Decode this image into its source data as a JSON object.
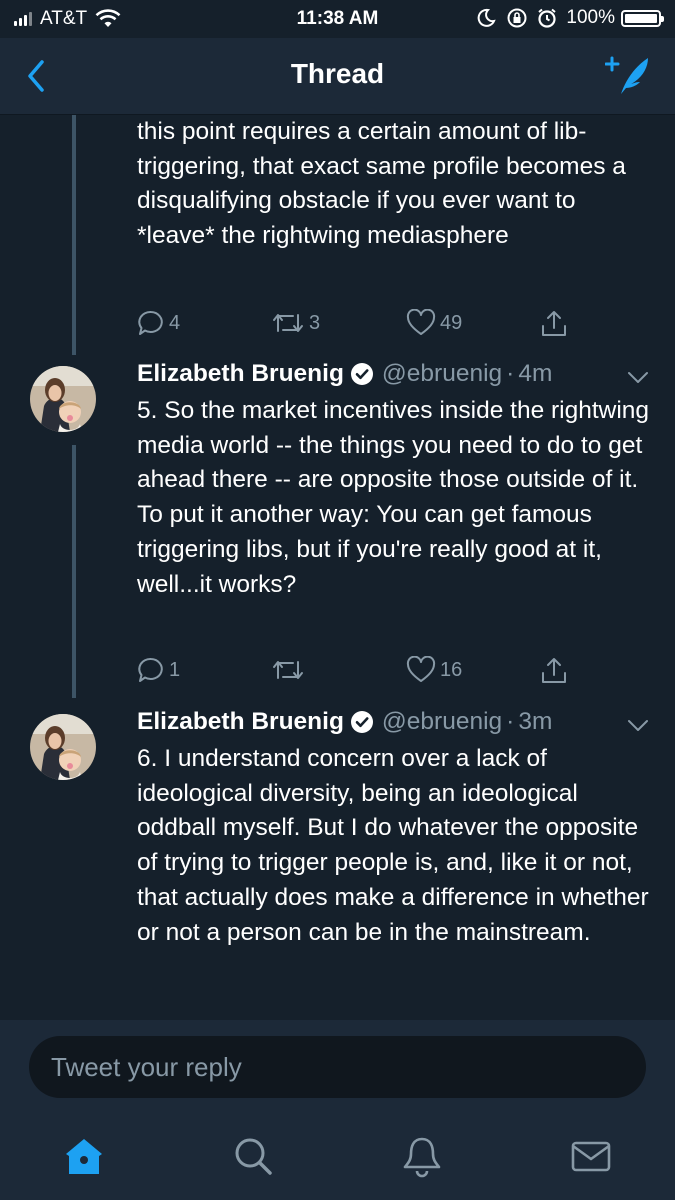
{
  "status_bar": {
    "carrier": "AT&T",
    "time": "11:38 AM",
    "battery": "100%"
  },
  "header": {
    "title": "Thread",
    "back_icon": "chevron-left-icon",
    "compose_icon": "compose-tweet-icon"
  },
  "tweets": [
    {
      "text": "this point requires a certain amount of lib-triggering, that exact same profile becomes a disqualifying obstacle if you ever want to *leave* the rightwing mediasphere",
      "replies": "4",
      "retweets": "3",
      "likes": "49"
    },
    {
      "name": "Elizabeth Bruenig",
      "handle": "@ebruenig",
      "separator": "·",
      "time": "4m",
      "text": "5. So the market incentives inside the rightwing media world -- the things you need to do to get ahead there -- are opposite those outside of it. To put it another way: You can get famous triggering libs, but if you're really good at it, well...it works?",
      "replies": "1",
      "retweets": "",
      "likes": "16"
    },
    {
      "name": "Elizabeth Bruenig",
      "handle": "@ebruenig",
      "separator": "·",
      "time": "3m",
      "text": "6. I understand concern over a lack of ideological diversity, being an ideological oddball myself. But I do whatever the opposite of trying to trigger people is, and, like it or not, that actually does make a difference in whether or not a person can be in the mainstream."
    }
  ],
  "reply": {
    "placeholder": "Tweet your reply"
  },
  "tab_bar": {
    "items": [
      "home-icon",
      "search-icon",
      "notifications-bell-icon",
      "messages-envelope-icon"
    ]
  },
  "colors": {
    "background": "#15202b",
    "bar_background": "#1c2938",
    "accent": "#1da1f2",
    "muted": "#8899a6"
  }
}
